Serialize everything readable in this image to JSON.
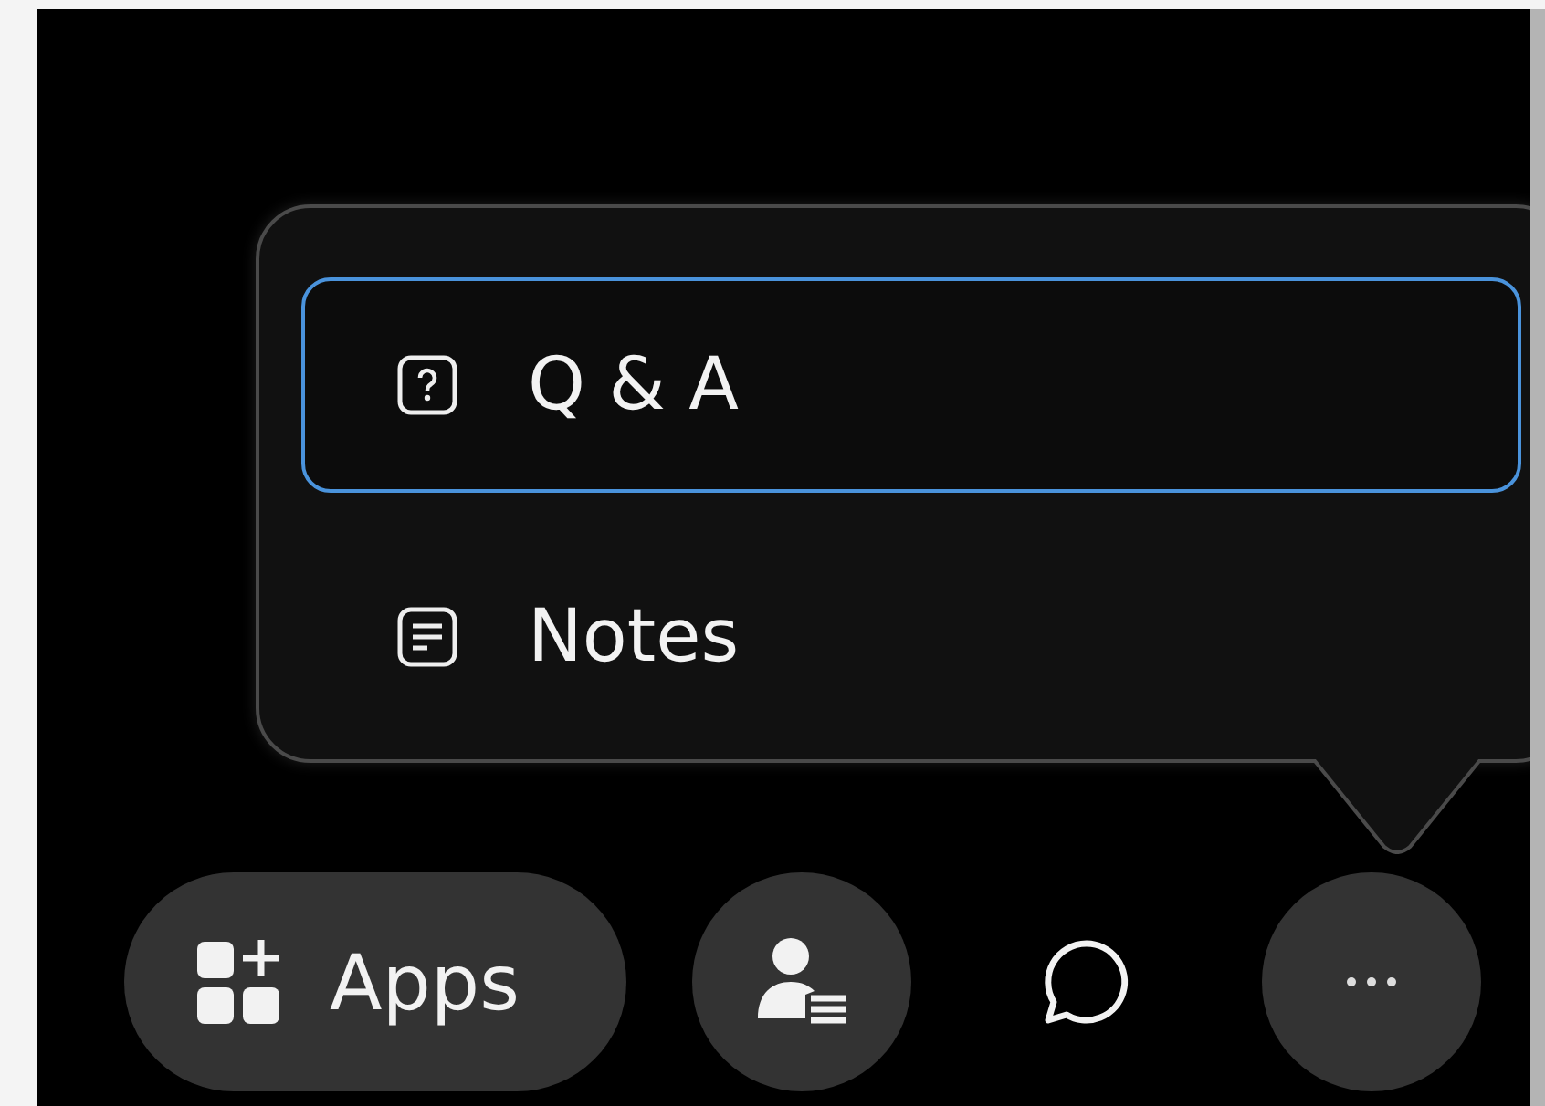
{
  "menu": {
    "items": [
      {
        "label": "Q & A",
        "selected": true
      },
      {
        "label": "Notes",
        "selected": false
      }
    ]
  },
  "toolbar": {
    "buttons": [
      {
        "kind": "pill",
        "label": "Apps"
      },
      {
        "kind": "filled"
      },
      {
        "kind": "plain"
      },
      {
        "kind": "filled"
      }
    ]
  }
}
